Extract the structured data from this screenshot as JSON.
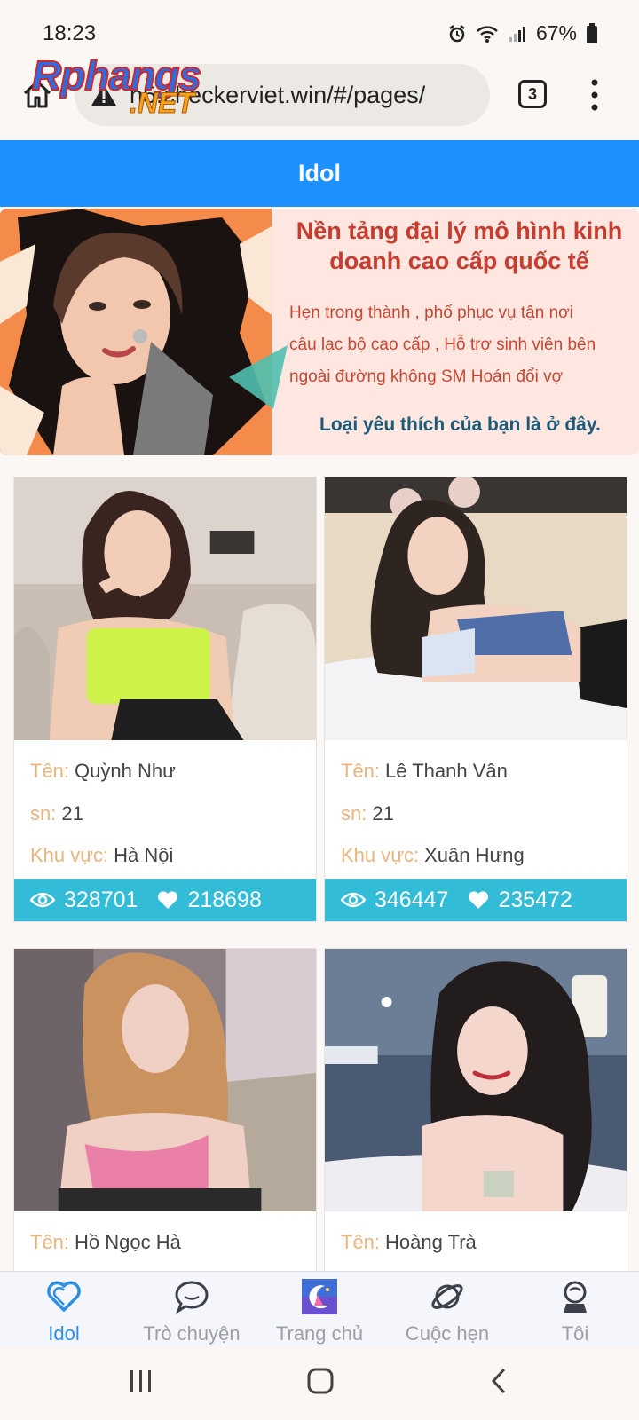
{
  "status": {
    "time": "18:23",
    "battery": "67%"
  },
  "browser": {
    "url": "h5.checkerviet.win/#/pages/",
    "tab_count": "3"
  },
  "watermark": {
    "top": "Rphangs",
    "bottom": ".NET"
  },
  "header": {
    "title": "Idol"
  },
  "banner": {
    "headline": "Nền tảng đại lý mô hình kinh doanh cao cấp quốc tế",
    "line1": "Hẹn trong thành , phố phục vụ tận nơi",
    "line2": "câu lạc bộ cao cấp , Hỗ trợ sinh viên bên",
    "line3": "ngoài đường không SM Hoán đổi vợ",
    "cta": "Loại yêu thích của bạn là ở đây."
  },
  "labels": {
    "name": "Tên:",
    "age": "sn:",
    "area": "Khu vực:"
  },
  "cards": [
    {
      "name": "Quỳnh Như",
      "age": "21",
      "area": "Hà Nội",
      "views": "328701",
      "likes": "218698"
    },
    {
      "name": "Lê Thanh Vân",
      "age": "21",
      "area": "Xuân Hưng",
      "views": "346447",
      "likes": "235472"
    },
    {
      "name": "Hồ Ngọc Hà"
    },
    {
      "name": "Hoàng Trà"
    }
  ],
  "nav": [
    {
      "label": "Idol",
      "icon": "heart-icon"
    },
    {
      "label": "Trò chuyện",
      "icon": "chat-icon"
    },
    {
      "label": "Trang chủ",
      "icon": "home-logo-icon"
    },
    {
      "label": "Cuộc hẹn",
      "icon": "planet-icon"
    },
    {
      "label": "Tôi",
      "icon": "user-icon"
    }
  ],
  "colors": {
    "header": "#1e90ff",
    "stat_bar": "#33bcd8",
    "label": "#e8b57d",
    "nav_active": "#2c8fe6"
  }
}
